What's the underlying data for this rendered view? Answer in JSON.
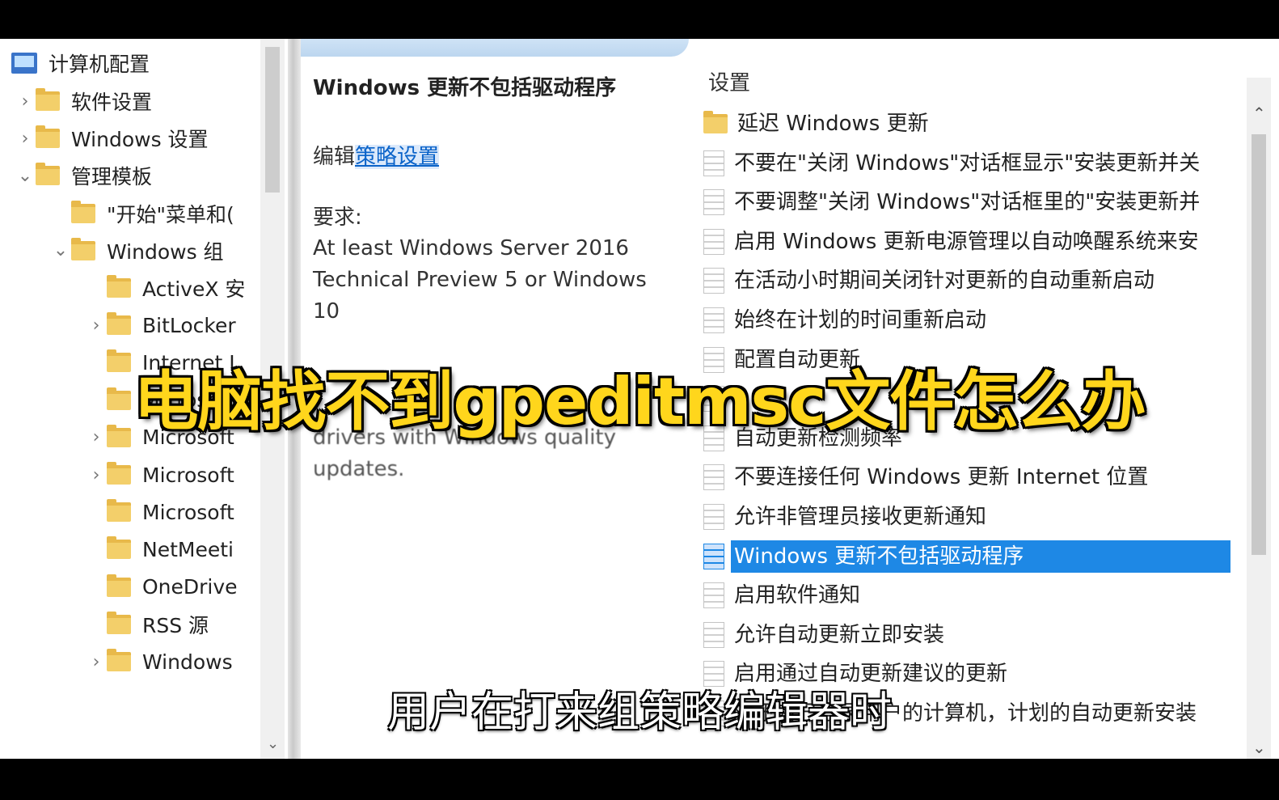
{
  "tree": {
    "root": {
      "label": "计算机配置",
      "icon": "computer-icon"
    },
    "items": [
      {
        "label": "软件设置",
        "chevron": ">",
        "level": 1
      },
      {
        "label": "Windows 设置",
        "chevron": ">",
        "level": 1
      },
      {
        "label": "管理模板",
        "chevron": "v",
        "level": 1
      },
      {
        "label": "\"开始\"菜单和(",
        "chevron": "",
        "level": 2
      },
      {
        "label": "Windows 组",
        "chevron": "v",
        "level": 2
      },
      {
        "label": "ActiveX 安",
        "chevron": "",
        "level": 3
      },
      {
        "label": "BitLocker",
        "chevron": ">",
        "level": 3
      },
      {
        "label": "Internet I",
        "chevron": "",
        "level": 3
      },
      {
        "label": "Microsoft",
        "chevron": "",
        "level": 3
      },
      {
        "label": "Microsoft",
        "chevron": ">",
        "level": 3
      },
      {
        "label": "Microsoft",
        "chevron": ">",
        "level": 3
      },
      {
        "label": "Microsoft",
        "chevron": "",
        "level": 3
      },
      {
        "label": "NetMeeti",
        "chevron": "",
        "level": 3
      },
      {
        "label": "OneDrive",
        "chevron": "",
        "level": 3
      },
      {
        "label": "RSS 源",
        "chevron": "",
        "level": 3
      },
      {
        "label": "Windows",
        "chevron": ">",
        "level": 3
      }
    ]
  },
  "description": {
    "title": "Windows 更新不包括驱动程序",
    "edit_prefix": "编辑",
    "edit_link": "策略设置",
    "requirements_label": "要求:",
    "requirements_text": "At least Windows Server 2016 Technical Preview 5 or Windows 10",
    "note_text": "drivers with Windows quality updates."
  },
  "settings": {
    "header": "设置",
    "items": [
      {
        "label": "延迟 Windows 更新",
        "type": "folder",
        "selected": false
      },
      {
        "label": "不要在\"关闭 Windows\"对话框显示\"安装更新并关",
        "type": "setting",
        "selected": false
      },
      {
        "label": "不要调整\"关闭 Windows\"对话框里的\"安装更新并",
        "type": "setting",
        "selected": false
      },
      {
        "label": "启用 Windows 更新电源管理以自动唤醒系统来安",
        "type": "setting",
        "selected": false
      },
      {
        "label": "在活动小时期间关闭针对更新的自动重新启动",
        "type": "setting",
        "selected": false
      },
      {
        "label": "始终在计划的时间重新启动",
        "type": "setting",
        "selected": false
      },
      {
        "label": "配置自动更新",
        "type": "setting",
        "selected": false
      },
      {
        "label": "",
        "type": "setting",
        "selected": false
      },
      {
        "label": "自动更新检测频率",
        "type": "setting",
        "selected": false
      },
      {
        "label": "不要连接任何 Windows 更新 Internet 位置",
        "type": "setting",
        "selected": false
      },
      {
        "label": "允许非管理员接收更新通知",
        "type": "setting",
        "selected": false
      },
      {
        "label": "Windows 更新不包括驱动程序",
        "type": "setting",
        "selected": true
      },
      {
        "label": "启用软件通知",
        "type": "setting",
        "selected": false
      },
      {
        "label": "允许自动更新立即安装",
        "type": "setting",
        "selected": false
      },
      {
        "label": "启用通过自动更新建议的更新",
        "type": "setting",
        "selected": false
      },
      {
        "label": "对于有已登录用户的计算机，计划的自动更新安装",
        "type": "setting",
        "selected": false
      }
    ]
  },
  "overlay": {
    "title": "电脑找不到gpeditmsc文件怎么办",
    "subtitle": "用户在打来组策略编辑器时"
  },
  "colors": {
    "selection": "#1e88e5",
    "overlay_title": "#ffd61c",
    "folder": "#f3cf6a"
  }
}
